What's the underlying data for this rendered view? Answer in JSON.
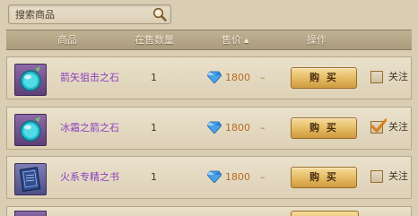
{
  "search": {
    "placeholder": "搜索商品",
    "value": ""
  },
  "header": {
    "col_item": "商品",
    "col_qty": "在售数量",
    "col_price": "售价",
    "col_action": "操作"
  },
  "rows": [
    {
      "name": "箭矢狙击之石",
      "qty": "1",
      "price": "1800",
      "extra": "–",
      "buy_label": "购 买",
      "follow_label": "关注",
      "followed": false,
      "icon": "cyan-orb-icon"
    },
    {
      "name": "冰霜之箭之石",
      "qty": "1",
      "price": "1800",
      "extra": "–",
      "buy_label": "购 买",
      "follow_label": "关注",
      "followed": true,
      "icon": "cyan-orb-icon"
    },
    {
      "name": "火系专精之书",
      "qty": "1",
      "price": "1800",
      "extra": "–",
      "buy_label": "购 买",
      "follow_label": "关注",
      "followed": false,
      "icon": "spell-book-icon"
    }
  ],
  "colors": {
    "item_name": "#8c3fbf",
    "price": "#b86c22",
    "button": "#e4b961"
  }
}
